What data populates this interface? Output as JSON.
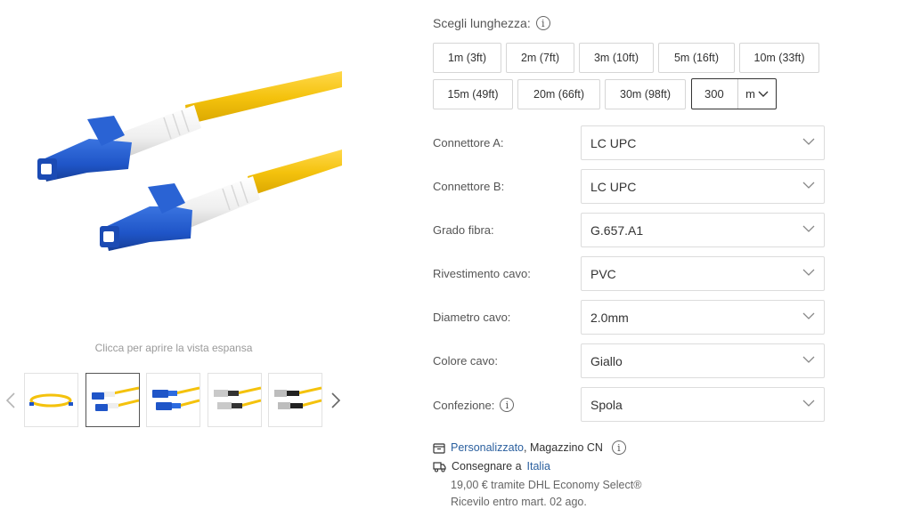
{
  "gallery": {
    "hint": "Clicca per aprire la vista espansa",
    "prev_icon": "chevron-left-icon",
    "next_icon": "chevron-right-icon",
    "thumbnails": [
      "coiled-yellow-cable",
      "lc-lc-yellow",
      "sc-sc-yellow",
      "fc-fc-yellow",
      "st-st-yellow"
    ],
    "active_thumbnail": 1
  },
  "length": {
    "label": "Scegli lunghezza:",
    "info_icon": "i",
    "options": [
      "1m (3ft)",
      "2m (7ft)",
      "3m (10ft)",
      "5m (16ft)",
      "10m (33ft)",
      "15m (49ft)",
      "20m (66ft)",
      "30m (98ft)"
    ],
    "custom_value": "300",
    "custom_unit": "m"
  },
  "options": [
    {
      "label": "Connettore A:",
      "value": "LC UPC"
    },
    {
      "label": "Connettore B:",
      "value": "LC UPC"
    },
    {
      "label": "Grado fibra:",
      "value": "G.657.A1"
    },
    {
      "label": "Rivestimento cavo:",
      "value": "PVC"
    },
    {
      "label": "Diametro cavo:",
      "value": "2.0mm"
    },
    {
      "label": "Colore cavo:",
      "value": "Giallo"
    },
    {
      "label": "Confezione:",
      "value": "Spola",
      "info": "i"
    }
  ],
  "delivery": {
    "custom_link": "Personalizzato",
    "warehouse": ", Magazzino CN",
    "ship_label": "Consegnare a",
    "ship_country": "Italia",
    "price_line": "19,00 € tramite DHL Economy Select®",
    "eta_line": "Ricevilo entro mart. 02 ago.",
    "info_icon": "i"
  },
  "colors": {
    "cable_yellow": "#f4c20d",
    "connector_blue": "#1f55c8",
    "boot_white": "#f2f2f2",
    "link_blue": "#2a5f9e"
  }
}
